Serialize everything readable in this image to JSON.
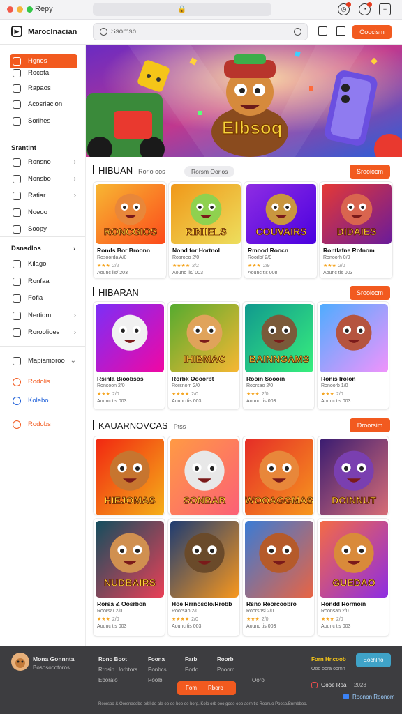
{
  "window": {
    "title": "Repy",
    "url": "🔒"
  },
  "header": {
    "app_name": "Maroclnacian",
    "search_placeholder": "Ssomsb",
    "signin_label": "Ooocism"
  },
  "sidebar": {
    "top_items": [
      {
        "label": "Hgnos",
        "icon": "home-icon",
        "active": true
      },
      {
        "label": "Rocota",
        "icon": "games-icon",
        "active": false
      },
      {
        "label": "Rapaos",
        "icon": "library-icon",
        "active": false
      },
      {
        "label": "Acosriacion",
        "icon": "gear-icon",
        "active": false
      },
      {
        "label": "Sorlhes",
        "icon": "user-icon",
        "active": false
      }
    ],
    "section1_title": "Srantint",
    "section1_items": [
      {
        "label": "Ronsno",
        "icon": "check-icon",
        "chevron": "›"
      },
      {
        "label": "Nonsbo",
        "icon": "search-icon",
        "chevron": "›"
      },
      {
        "label": "Ratiar",
        "icon": "chart-icon",
        "chevron": "›"
      },
      {
        "label": "Noeoo",
        "icon": "image-icon",
        "chevron": ""
      },
      {
        "label": "Soopy",
        "icon": "doc-icon",
        "chevron": ""
      }
    ],
    "section2_title": "Dsnsdlos",
    "section2_items": [
      {
        "label": "Kilago",
        "icon": "grid-icon",
        "chevron": ""
      },
      {
        "label": "Ronfaa",
        "icon": "flag-icon",
        "chevron": ""
      },
      {
        "label": "Fofla",
        "icon": "bell-icon",
        "chevron": ""
      },
      {
        "label": "Nertiom",
        "icon": "chat-icon",
        "chevron": "›"
      },
      {
        "label": "Roroolioes",
        "icon": "list-icon",
        "chevron": "›"
      }
    ],
    "extra_items": [
      {
        "label": "Mapiamoroo",
        "icon": "globe-icon",
        "chevron": "⌄",
        "color": "#333333"
      },
      {
        "label": "Rodolis",
        "icon": "check-circle-icon",
        "chevron": "",
        "color": "#f25a1f"
      },
      {
        "label": "Kolebo",
        "icon": "badge-icon",
        "chevron": "",
        "color": "#1e5fd8"
      },
      {
        "label": "Rodobs",
        "icon": "star-icon",
        "chevron": "",
        "color": "#f25a1f"
      }
    ]
  },
  "hero": {
    "title": "EIbsoq"
  },
  "sections": [
    {
      "title": "HIBUAN",
      "subtitle": "Rorlo oos",
      "pill": "Rorsm Oorlos",
      "see_all": "Srooiocm",
      "cards": [
        {
          "art": "RONCGIOS",
          "title": "Ronds Bor Broonn",
          "line1": "Rosoorda A/0",
          "rating": "★★★",
          "rating_text": "2/2",
          "line2": "Aounc lis/ 203"
        },
        {
          "art": "RINIIELS",
          "title": "Nond for Hortnol",
          "line1": "Rosroeo 2/0",
          "rating": "★★★★",
          "rating_text": "2/2",
          "line2": "Aounc lis/ 003"
        },
        {
          "art": "COUVAIRS",
          "title": "Rmood Roocn",
          "line1": "Roorlo/ 2/9",
          "rating": "★★★",
          "rating_text": "2/9",
          "line2": "Aounc tis 008"
        },
        {
          "art": "DIDAIES",
          "title": "Rontlafne Rofnom",
          "line1": "Ronoorh 0/9",
          "rating": "★★★",
          "rating_text": "2/0",
          "line2": "Aounc tis 003"
        }
      ]
    },
    {
      "title": "HIBARAN",
      "subtitle": "",
      "pill": "",
      "see_all": "Srooiocm",
      "cards": [
        {
          "art": "",
          "title": "Rsinla Bioobsos",
          "line1": "Ronsoon 2/0",
          "rating": "★★★",
          "rating_text": "2/0",
          "line2": "Aounc tis 003"
        },
        {
          "art": "IHIBMAC",
          "title": "Rorbk Oooorbt",
          "line1": "Rorsnom 2/0",
          "rating": "★★★★",
          "rating_text": "2/0",
          "line2": "Aounc tis 003"
        },
        {
          "art": "BAINNGAMS",
          "title": "Rooin Soooin",
          "line1": "Roorsao 2/0",
          "rating": "★★★",
          "rating_text": "2/0",
          "line2": "Aounc tis 003"
        },
        {
          "art": "",
          "title": "Ronis Irolon",
          "line1": "Ronoorb 1/0",
          "rating": "★★★",
          "rating_text": "2/0",
          "line2": "Aounc tis 003"
        }
      ]
    },
    {
      "title": "KAUARNOVCAS",
      "subtitle": "Ptss",
      "pill": "",
      "see_all": "Droorsim",
      "cards": [
        {
          "art": "HIEJOMAS",
          "title": "",
          "line1": "",
          "rating": "",
          "rating_text": "",
          "line2": ""
        },
        {
          "art": "SONBAR",
          "title": "",
          "line1": "",
          "rating": "",
          "rating_text": "",
          "line2": ""
        },
        {
          "art": "WOOAGGMAS",
          "title": "",
          "line1": "",
          "rating": "",
          "rating_text": "",
          "line2": ""
        },
        {
          "art": "DOINNUT",
          "title": "",
          "line1": "",
          "rating": "",
          "rating_text": "",
          "line2": ""
        },
        {
          "art": "NUDBAIRS",
          "title": "Rorsa & Oosrbon",
          "line1": "Roorsa/ 2/0",
          "rating": "★★★",
          "rating_text": "2/0",
          "line2": "Aounc tis 003"
        },
        {
          "art": "",
          "title": "Hoe Rrrnosolo/Rrobb",
          "line1": "Roorsao 2/0",
          "rating": "★★★★",
          "rating_text": "2/0",
          "line2": "Aounc tis 003"
        },
        {
          "art": "",
          "title": "Rsno Reorcoobro",
          "line1": "Roorsnsi 2/0",
          "rating": "★★★",
          "rating_text": "2/0",
          "line2": "Aounc tis 003"
        },
        {
          "art": "GUEDAO",
          "title": "Rondd Rormoin",
          "line1": "Roonsan 2/0",
          "rating": "★★★",
          "rating_text": "2/0",
          "line2": "Aounc tis 003"
        }
      ]
    }
  ],
  "footer": {
    "brand_name": "Mona Gonnnta",
    "brand_sub": "Bososocotoros",
    "col1": [
      "Rono Boot",
      "Rrosin Uorbtors",
      "Eboralo"
    ],
    "col2": [
      "Foona",
      "Ponbcs",
      "Poolb"
    ],
    "col3": [
      "Farb",
      "Porfo",
      ""
    ],
    "col4": [
      "Roorb",
      "Pooom",
      "Ooro"
    ],
    "promo_title": "Forn Hncoob",
    "promo_sub": "Ooo oora oomn",
    "cta": "Eochlno",
    "social1": "Gooe Roa",
    "social1_count": "2023",
    "social2": "Roonon Roonom",
    "bottom_btn1": "Fom",
    "bottom_btn2": "Rboro",
    "copyright": "Roorsoo & Oorsnaoobo orbl do ala oo oo boo oo borg. Kolo orb ooo gooo ooo aorh tlo Roonuo Pooso/Bnmbboo."
  }
}
